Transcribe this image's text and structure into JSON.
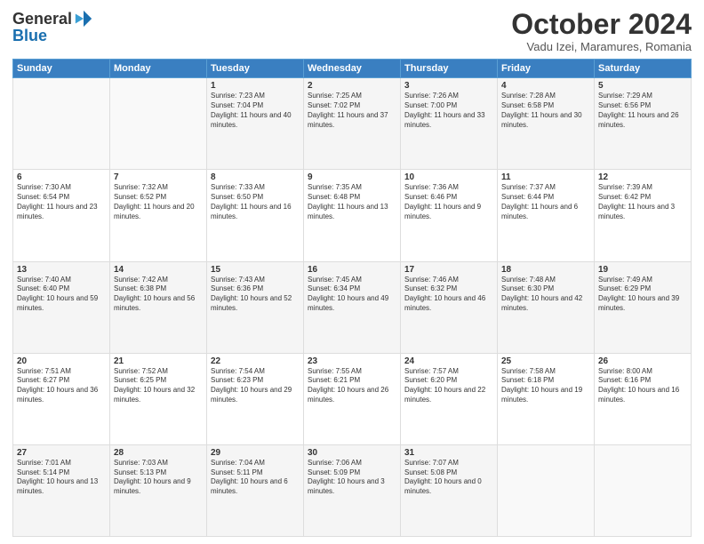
{
  "header": {
    "logo_general": "General",
    "logo_blue": "Blue",
    "month_title": "October 2024",
    "location": "Vadu Izei, Maramures, Romania"
  },
  "weekdays": [
    "Sunday",
    "Monday",
    "Tuesday",
    "Wednesday",
    "Thursday",
    "Friday",
    "Saturday"
  ],
  "weeks": [
    [
      {
        "day": "",
        "info": ""
      },
      {
        "day": "",
        "info": ""
      },
      {
        "day": "1",
        "info": "Sunrise: 7:23 AM\nSunset: 7:04 PM\nDaylight: 11 hours and 40 minutes."
      },
      {
        "day": "2",
        "info": "Sunrise: 7:25 AM\nSunset: 7:02 PM\nDaylight: 11 hours and 37 minutes."
      },
      {
        "day": "3",
        "info": "Sunrise: 7:26 AM\nSunset: 7:00 PM\nDaylight: 11 hours and 33 minutes."
      },
      {
        "day": "4",
        "info": "Sunrise: 7:28 AM\nSunset: 6:58 PM\nDaylight: 11 hours and 30 minutes."
      },
      {
        "day": "5",
        "info": "Sunrise: 7:29 AM\nSunset: 6:56 PM\nDaylight: 11 hours and 26 minutes."
      }
    ],
    [
      {
        "day": "6",
        "info": "Sunrise: 7:30 AM\nSunset: 6:54 PM\nDaylight: 11 hours and 23 minutes."
      },
      {
        "day": "7",
        "info": "Sunrise: 7:32 AM\nSunset: 6:52 PM\nDaylight: 11 hours and 20 minutes."
      },
      {
        "day": "8",
        "info": "Sunrise: 7:33 AM\nSunset: 6:50 PM\nDaylight: 11 hours and 16 minutes."
      },
      {
        "day": "9",
        "info": "Sunrise: 7:35 AM\nSunset: 6:48 PM\nDaylight: 11 hours and 13 minutes."
      },
      {
        "day": "10",
        "info": "Sunrise: 7:36 AM\nSunset: 6:46 PM\nDaylight: 11 hours and 9 minutes."
      },
      {
        "day": "11",
        "info": "Sunrise: 7:37 AM\nSunset: 6:44 PM\nDaylight: 11 hours and 6 minutes."
      },
      {
        "day": "12",
        "info": "Sunrise: 7:39 AM\nSunset: 6:42 PM\nDaylight: 11 hours and 3 minutes."
      }
    ],
    [
      {
        "day": "13",
        "info": "Sunrise: 7:40 AM\nSunset: 6:40 PM\nDaylight: 10 hours and 59 minutes."
      },
      {
        "day": "14",
        "info": "Sunrise: 7:42 AM\nSunset: 6:38 PM\nDaylight: 10 hours and 56 minutes."
      },
      {
        "day": "15",
        "info": "Sunrise: 7:43 AM\nSunset: 6:36 PM\nDaylight: 10 hours and 52 minutes."
      },
      {
        "day": "16",
        "info": "Sunrise: 7:45 AM\nSunset: 6:34 PM\nDaylight: 10 hours and 49 minutes."
      },
      {
        "day": "17",
        "info": "Sunrise: 7:46 AM\nSunset: 6:32 PM\nDaylight: 10 hours and 46 minutes."
      },
      {
        "day": "18",
        "info": "Sunrise: 7:48 AM\nSunset: 6:30 PM\nDaylight: 10 hours and 42 minutes."
      },
      {
        "day": "19",
        "info": "Sunrise: 7:49 AM\nSunset: 6:29 PM\nDaylight: 10 hours and 39 minutes."
      }
    ],
    [
      {
        "day": "20",
        "info": "Sunrise: 7:51 AM\nSunset: 6:27 PM\nDaylight: 10 hours and 36 minutes."
      },
      {
        "day": "21",
        "info": "Sunrise: 7:52 AM\nSunset: 6:25 PM\nDaylight: 10 hours and 32 minutes."
      },
      {
        "day": "22",
        "info": "Sunrise: 7:54 AM\nSunset: 6:23 PM\nDaylight: 10 hours and 29 minutes."
      },
      {
        "day": "23",
        "info": "Sunrise: 7:55 AM\nSunset: 6:21 PM\nDaylight: 10 hours and 26 minutes."
      },
      {
        "day": "24",
        "info": "Sunrise: 7:57 AM\nSunset: 6:20 PM\nDaylight: 10 hours and 22 minutes."
      },
      {
        "day": "25",
        "info": "Sunrise: 7:58 AM\nSunset: 6:18 PM\nDaylight: 10 hours and 19 minutes."
      },
      {
        "day": "26",
        "info": "Sunrise: 8:00 AM\nSunset: 6:16 PM\nDaylight: 10 hours and 16 minutes."
      }
    ],
    [
      {
        "day": "27",
        "info": "Sunrise: 7:01 AM\nSunset: 5:14 PM\nDaylight: 10 hours and 13 minutes."
      },
      {
        "day": "28",
        "info": "Sunrise: 7:03 AM\nSunset: 5:13 PM\nDaylight: 10 hours and 9 minutes."
      },
      {
        "day": "29",
        "info": "Sunrise: 7:04 AM\nSunset: 5:11 PM\nDaylight: 10 hours and 6 minutes."
      },
      {
        "day": "30",
        "info": "Sunrise: 7:06 AM\nSunset: 5:09 PM\nDaylight: 10 hours and 3 minutes."
      },
      {
        "day": "31",
        "info": "Sunrise: 7:07 AM\nSunset: 5:08 PM\nDaylight: 10 hours and 0 minutes."
      },
      {
        "day": "",
        "info": ""
      },
      {
        "day": "",
        "info": ""
      }
    ]
  ]
}
